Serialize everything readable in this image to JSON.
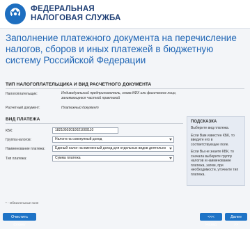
{
  "header": {
    "org_line1": "ФЕДЕРАЛЬНАЯ",
    "org_line2": "НАЛОГОВАЯ СЛУЖБА",
    "brand_color": "#1d6ec0"
  },
  "page_title": "Заполнение платежного документа на перечисление налогов, сборов и иных платежей в бюджетную систему Российской Федерации",
  "section1": {
    "title": "ТИП НАЛОГОПЛАТЕЛЬЩИКА И ВИД РАСЧЕТНОГО ДОКУМЕНТА",
    "payer_label": "Налогоплательщик:",
    "payer_value": "Индивидуальный предприниматель, глава КФХ или физическое лицо, занимающееся частной практикой",
    "doc_label": "Расчетный документ:",
    "doc_value": "Платежный документ"
  },
  "section2": {
    "title": "ВИД ПЛАТЕЖА",
    "kbk_label": "КБК:",
    "kbk_value": "18210502010021000110",
    "tax_group_label": "Группа налогов:",
    "tax_group_value": "Налоги на совокупный доход",
    "payment_name_label": "Наименование платежа:",
    "payment_name_value": "Единый налог на вмененный доход для отдельных видов деятельно",
    "payment_type_label": "Тип платежа:",
    "payment_type_value": "Сумма платежа"
  },
  "hint": {
    "title": "ПОДСКАЗКА",
    "p1": "Выберите вид платежа.",
    "p2": "Если Вам известен КБК, то введите его в соответствующее поле.",
    "p3": "Если Вы не знаете КБК, то сначала выберите группу налогов и наименование платежа, затем, при необходимости, уточните тип платежа."
  },
  "footnote": "* - Обязательные поля",
  "buttons": {
    "clear": "Очистить форму",
    "back": "<<< Назад",
    "next": "Далее >>"
  },
  "colors": {
    "button_bg": "#1e73c6",
    "title_color": "#1d64b4",
    "required_mark": "#d23b2a"
  }
}
